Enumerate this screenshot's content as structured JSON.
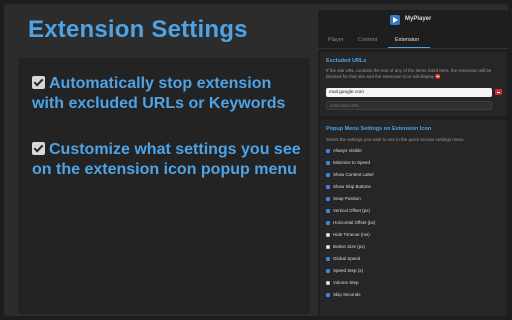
{
  "headline": "Extension Settings",
  "features": [
    {
      "text": "Automatically stop extension with excluded URLs or Keywords"
    },
    {
      "text": "Customize what settings you see on the extension icon popup menu"
    }
  ],
  "popup": {
    "app_name": "MyPlayer",
    "tabs": [
      {
        "label": "Player",
        "active": false
      },
      {
        "label": "Content",
        "active": false
      },
      {
        "label": "Extension",
        "active": true
      }
    ],
    "excluded": {
      "title": "Excluded URLs",
      "description": "If the site URL contains the text of any of the items listed here, the extension will be blocked for that site and the extension icon will display ⛔",
      "urls": [
        "mail.google.com"
      ],
      "new_placeholder": "Add new URL"
    },
    "popup_menu": {
      "title": "Popup Menu Settings on Extension Icon",
      "description": "Select the settings you wish to see in the quick access settings menu.",
      "options": [
        {
          "label": "Always Visible",
          "checked": true
        },
        {
          "label": "Minimize to Speed",
          "checked": true
        },
        {
          "label": "Show Content Label",
          "checked": true
        },
        {
          "label": "Show Skip Buttons",
          "checked": true
        },
        {
          "label": "Snap Position",
          "checked": true
        },
        {
          "label": "Vertical Offset (px)",
          "checked": true
        },
        {
          "label": "Horizontal Offset (px)",
          "checked": true
        },
        {
          "label": "Hide Timeout (ms)",
          "checked": false
        },
        {
          "label": "Button Size (px)",
          "checked": false
        },
        {
          "label": "Global Speed",
          "checked": true
        },
        {
          "label": "Speed Step (x)",
          "checked": true
        },
        {
          "label": "Volume Step",
          "checked": false
        },
        {
          "label": "Skip Seconds",
          "checked": true
        }
      ]
    }
  },
  "colors": {
    "accent": "#4ea3e6",
    "checkbox_on": "#3c82e0",
    "remove": "#cc3030"
  }
}
